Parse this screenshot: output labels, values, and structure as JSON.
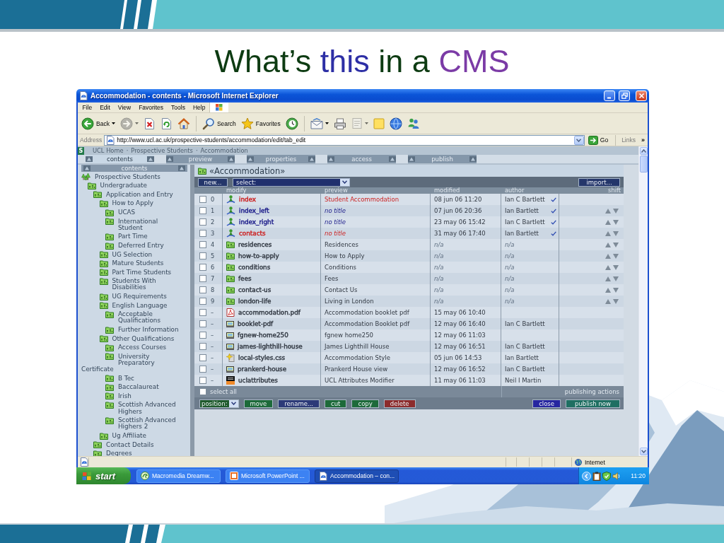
{
  "slide": {
    "title": [
      {
        "text": "What’s",
        "color": "#0d3b12"
      },
      {
        "text": "this",
        "color": "#2d2fa5"
      },
      {
        "text": "in a",
        "color": "#0d3b12"
      },
      {
        "text": "CMS",
        "color": "#7b3ba6"
      }
    ]
  },
  "window": {
    "title": "Accommodation - contents - Microsoft Internet Explorer"
  },
  "menu": [
    "File",
    "Edit",
    "View",
    "Favorites",
    "Tools",
    "Help"
  ],
  "toolbar": [
    {
      "kind": "back",
      "label": "Back",
      "disabled": false
    },
    {
      "kind": "forward",
      "disabled": true
    },
    {
      "kind": "stop",
      "disabled": false
    },
    {
      "kind": "refresh",
      "disabled": false
    },
    {
      "kind": "home",
      "disabled": false
    },
    {
      "kind": "search",
      "label": "Search",
      "disabled": false
    },
    {
      "kind": "favorites",
      "label": "Favorites",
      "disabled": false
    },
    {
      "kind": "history",
      "disabled": false
    },
    {
      "kind": "mail",
      "disabled": false
    },
    {
      "kind": "print",
      "disabled": false
    },
    {
      "kind": "edit",
      "disabled": true
    },
    {
      "kind": "note",
      "disabled": false
    },
    {
      "kind": "globe",
      "disabled": false
    },
    {
      "kind": "messenger",
      "disabled": false
    }
  ],
  "address": {
    "label": "Address",
    "value": "http://www.ucl.ac.uk/prospective-students/accommodation/edit/tab_edit",
    "go": "Go",
    "links": "Links",
    "more": "»"
  },
  "cms": {
    "logo": "S",
    "breadcrumb": [
      "UCL Home",
      "Prospective Students",
      "Accommodation"
    ],
    "separator": "·",
    "tabs": [
      {
        "label": "contents",
        "selected": true
      },
      {
        "label": "preview",
        "selected": false
      },
      {
        "label": "properties",
        "selected": false
      },
      {
        "label": "access",
        "selected": false
      },
      {
        "label": "publish",
        "selected": false
      }
    ],
    "sidebar": {
      "header": "contents",
      "tree": [
        {
          "label": "Prospective Students",
          "kind": "group",
          "children": [
            {
              "label": "Undergraduate",
              "kind": "folder",
              "children": [
                {
                  "label": "Application and Entry",
                  "kind": "folder",
                  "children": [
                    {
                      "label": "How to Apply",
                      "kind": "folder",
                      "children": [
                        {
                          "label": "UCAS",
                          "kind": "folder"
                        },
                        {
                          "label": "International Student",
                          "kind": "folder"
                        },
                        {
                          "label": "Part Time",
                          "kind": "folder"
                        },
                        {
                          "label": "Deferred Entry",
                          "kind": "folder"
                        }
                      ]
                    },
                    {
                      "label": "UG Selection",
                      "kind": "folder"
                    },
                    {
                      "label": "Mature Students",
                      "kind": "folder"
                    },
                    {
                      "label": "Part Time Students",
                      "kind": "folder"
                    },
                    {
                      "label": "Students With Disabilities",
                      "kind": "folder"
                    },
                    {
                      "label": "UG Requirements",
                      "kind": "folder"
                    },
                    {
                      "label": "English Language",
                      "kind": "folder",
                      "children": [
                        {
                          "label": "Acceptable Qualifications",
                          "kind": "folder"
                        },
                        {
                          "label": "Further Information",
                          "kind": "folder"
                        }
                      ]
                    },
                    {
                      "label": "Other Qualifications",
                      "kind": "folder",
                      "children": [
                        {
                          "label": "Access Courses",
                          "kind": "folder"
                        },
                        {
                          "label": "University Preparatory Certificate",
                          "kind": "folder"
                        },
                        {
                          "label": "B Tec",
                          "kind": "folder"
                        },
                        {
                          "label": "Baccalaureat",
                          "kind": "folder"
                        },
                        {
                          "label": "Irish",
                          "kind": "folder"
                        },
                        {
                          "label": "Scottish Advanced Highers",
                          "kind": "folder"
                        },
                        {
                          "label": "Scottish Advanced Highers 2",
                          "kind": "folder"
                        }
                      ]
                    },
                    {
                      "label": "Ug Affiliate",
                      "kind": "folder"
                    }
                  ]
                },
                {
                  "label": "Contact Details",
                  "kind": "folder"
                },
                {
                  "label": "Degrees",
                  "kind": "folder"
                }
              ]
            }
          ]
        }
      ]
    },
    "folder": {
      "title": "«Accommodation»",
      "new_button": "new...",
      "select": "select:",
      "import_button": "import..."
    },
    "table": {
      "columns": [
        "modify",
        "preview",
        "modified",
        "author",
        "shift"
      ],
      "rows": [
        {
          "checked": false,
          "number": "0",
          "kind": "page",
          "name": "index",
          "color": "#cc2222",
          "preview": "Student Accommodation",
          "untitled": false,
          "modified": "08 jun 06 11:20",
          "author": "Ian C Bartlett",
          "undated": false,
          "approved": true,
          "movable": false
        },
        {
          "checked": false,
          "number": "1",
          "kind": "page",
          "name": "index_left",
          "color": "#1c1c8a",
          "preview": "no title",
          "untitled": true,
          "modified": "07 jun 06 20:36",
          "author": "Ian Bartlett",
          "undated": false,
          "approved": true,
          "movable": true
        },
        {
          "checked": false,
          "number": "2",
          "kind": "page",
          "name": "index_right",
          "color": "#1c1c8a",
          "preview": "no title",
          "untitled": true,
          "modified": "23 may 06 15:42",
          "author": "Ian C Bartlett",
          "undated": false,
          "approved": true,
          "movable": true
        },
        {
          "checked": false,
          "number": "3",
          "kind": "page",
          "name": "contacts",
          "color": "#cc2222",
          "preview": "no title",
          "untitled": true,
          "modified": "31 may 06 17:40",
          "author": "Ian Bartlett",
          "undated": false,
          "approved": true,
          "movable": true
        },
        {
          "checked": false,
          "number": "4",
          "kind": "folder",
          "name": "residences",
          "color": "#333a44",
          "preview": "Residences",
          "untitled": false,
          "modified": "n/a",
          "author": "n/a",
          "undated": true,
          "approved": false,
          "movable": true
        },
        {
          "checked": false,
          "number": "5",
          "kind": "folder",
          "name": "how-to-apply",
          "color": "#333a44",
          "preview": "How to Apply",
          "untitled": false,
          "modified": "n/a",
          "author": "n/a",
          "undated": true,
          "approved": false,
          "movable": true
        },
        {
          "checked": false,
          "number": "6",
          "kind": "folder",
          "name": "conditions",
          "color": "#333a44",
          "preview": "Conditions",
          "untitled": false,
          "modified": "n/a",
          "author": "n/a",
          "undated": true,
          "approved": false,
          "movable": true
        },
        {
          "checked": false,
          "number": "7",
          "kind": "folder",
          "name": "fees",
          "color": "#333a44",
          "preview": "Fees",
          "untitled": false,
          "modified": "n/a",
          "author": "n/a",
          "undated": true,
          "approved": false,
          "movable": true
        },
        {
          "checked": false,
          "number": "8",
          "kind": "folder",
          "name": "contact-us",
          "color": "#333a44",
          "preview": "Contact Us",
          "untitled": false,
          "modified": "n/a",
          "author": "n/a",
          "undated": true,
          "approved": false,
          "movable": true
        },
        {
          "checked": false,
          "number": "9",
          "kind": "folder",
          "name": "london-life",
          "color": "#333a44",
          "preview": "Living in London",
          "untitled": false,
          "modified": "n/a",
          "author": "n/a",
          "undated": true,
          "approved": false,
          "movable": true
        },
        {
          "checked": false,
          "number": "–",
          "kind": "pdf",
          "name": "accommodation.pdf",
          "color": "#333a44",
          "preview": "Accommodation booklet pdf",
          "untitled": false,
          "modified": "15 may 06 10:40",
          "undated": false,
          "approved": false,
          "movable": false
        },
        {
          "checked": false,
          "number": "–",
          "kind": "image",
          "name": "booklet-pdf",
          "color": "#333a44",
          "preview": "Accommodation Booklet pdf",
          "untitled": false,
          "modified": "12 may 06 16:40",
          "author": "Ian C Bartlett",
          "undated": false,
          "approved": false,
          "movable": false
        },
        {
          "checked": false,
          "number": "–",
          "kind": "image",
          "name": "fgnew-home250",
          "color": "#333a44",
          "preview": "fgnew home250",
          "untitled": false,
          "modified": "12 may 06 11:03",
          "undated": false,
          "approved": false,
          "movable": false
        },
        {
          "checked": false,
          "number": "–",
          "kind": "image",
          "name": "james-lighthill-house",
          "color": "#333a44",
          "preview": "James Lighthill House",
          "untitled": false,
          "modified": "12 may 06 16:51",
          "author": "Ian C Bartlett",
          "undated": false,
          "approved": false,
          "movable": false
        },
        {
          "checked": false,
          "number": "–",
          "kind": "css",
          "name": "local-styles.css",
          "color": "#333a44",
          "preview": "Accommodation Style",
          "untitled": false,
          "modified": "05 jun 06 14:53",
          "author": "Ian Bartlett",
          "undated": false,
          "approved": false,
          "movable": false
        },
        {
          "checked": false,
          "number": "–",
          "kind": "image",
          "name": "prankerd-house",
          "color": "#333a44",
          "preview": "Prankerd House view",
          "untitled": false,
          "modified": "12 may 06 16:52",
          "author": "Ian C Bartlett",
          "undated": false,
          "approved": false,
          "movable": false
        },
        {
          "checked": false,
          "number": "–",
          "kind": "tile",
          "name": "uclattributes",
          "color": "#333a44",
          "preview": "UCL Attributes Modifier",
          "untitled": false,
          "modified": "11 may 06 11:03",
          "author": "Neil I Martin",
          "undated": false,
          "approved": false,
          "movable": false
        }
      ]
    },
    "footer": {
      "select_all": {
        "label": "select all",
        "checked": false
      },
      "publishing_label": "publishing actions",
      "position": "position:",
      "actions": [
        {
          "label": "move",
          "color": "#1d6a3a"
        },
        {
          "label": "rename...",
          "color": "#2c3a78"
        },
        {
          "label": "cut",
          "color": "#1d6a3a"
        },
        {
          "label": "copy",
          "color": "#1d6a3a"
        },
        {
          "label": "delete",
          "color": "#8c2c2c"
        }
      ],
      "publishing": [
        {
          "label": "close",
          "color": "#2626a0"
        },
        {
          "label": "publish now",
          "color": "#1f6f62"
        }
      ]
    }
  },
  "status_bar": {
    "zone": "Internet"
  },
  "taskbar": {
    "start": "start",
    "tasks": [
      {
        "kind": "editor",
        "label": "Macromedia Dreamw...",
        "selected": false
      },
      {
        "kind": "presentation",
        "label": "Microsoft PowerPoint ...",
        "selected": false
      },
      {
        "kind": "browser",
        "label": "Accommodation – con...",
        "selected": true
      }
    ],
    "clock": "11:20"
  }
}
